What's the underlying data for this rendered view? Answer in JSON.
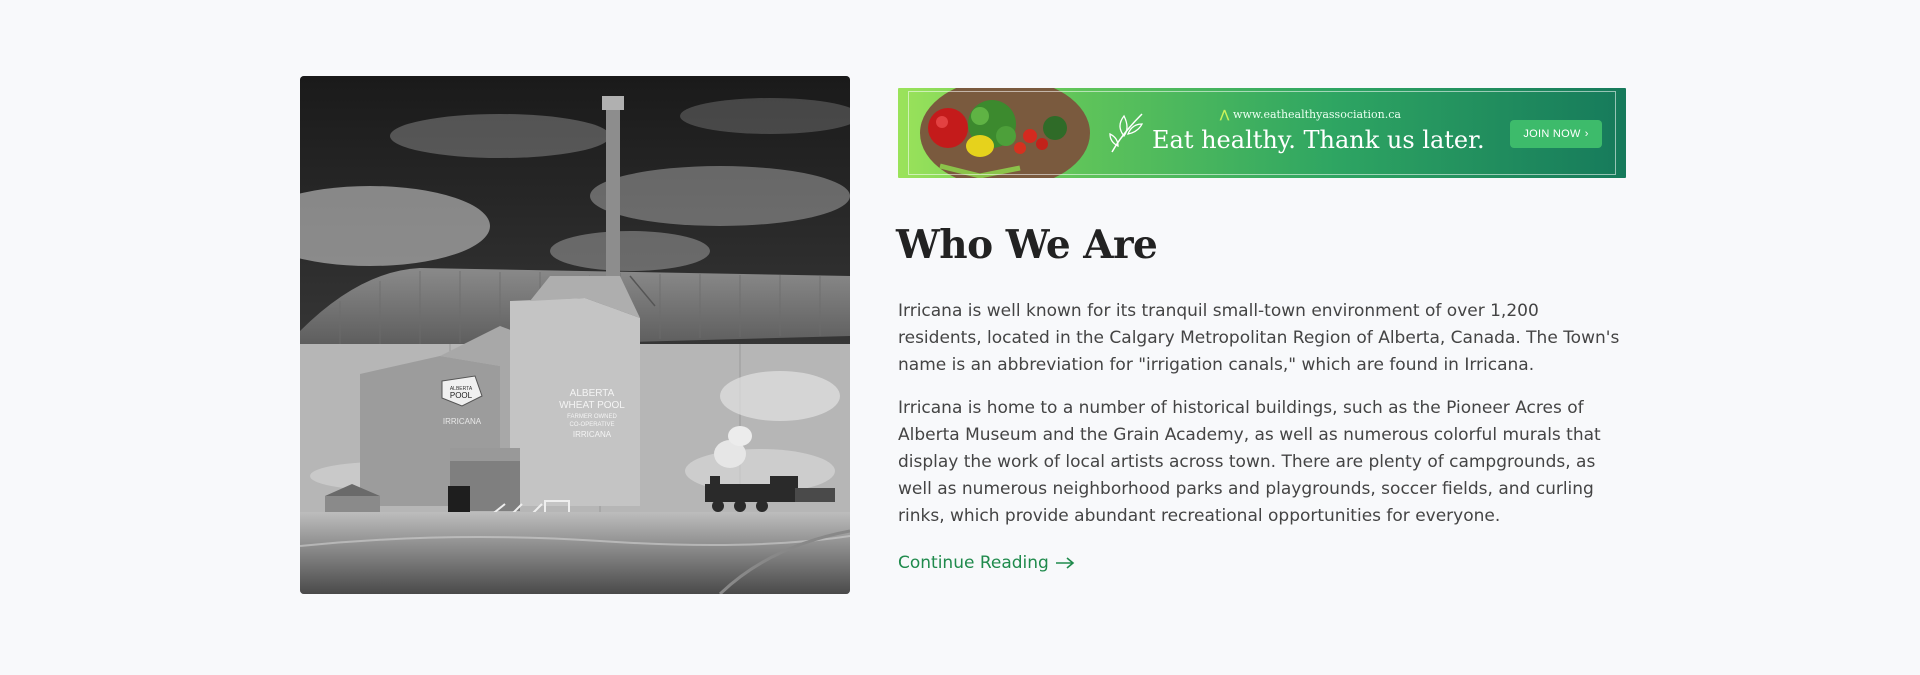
{
  "image": {
    "icon": "grain-elevator-mural-photo"
  },
  "banner": {
    "url": "www.eathealthyassociation.ca",
    "slogan": "Eat healthy. Thank us later.",
    "button_label": "JOIN NOW",
    "colors": {
      "start": "#9be35a",
      "end": "#167a5b",
      "button": "#3dbb6b"
    }
  },
  "article": {
    "title": "Who We Are",
    "paragraphs": [
      "Irricana is well known for its tranquil small-town environment of over 1,200 residents, located in the Calgary Metropolitan Region of Alberta, Canada. The Town's name is an abbreviation for \"irrigation canals,\" which are found in Irricana.",
      "Irricana is home to a number of historical buildings, such as the Pioneer Acres of Alberta Museum and the Grain Academy, as well as numerous colorful murals that display the work of local artists across town. There are plenty of campgrounds, as well as numerous neighborhood parks and playgrounds, soccer fields, and curling rinks, which provide abundant recreational opportunities for everyone."
    ],
    "link_label": "Continue Reading",
    "link_color": "#1f8a4c"
  },
  "mural_text": {
    "left_sign": [
      "ALBERTA",
      "POOL"
    ],
    "left_name": "IRRICANA",
    "right_sign": [
      "ALBERTA",
      "WHEAT POOL",
      "FARMER OWNED",
      "CO-OPERATIVE",
      "IRRICANA"
    ]
  }
}
